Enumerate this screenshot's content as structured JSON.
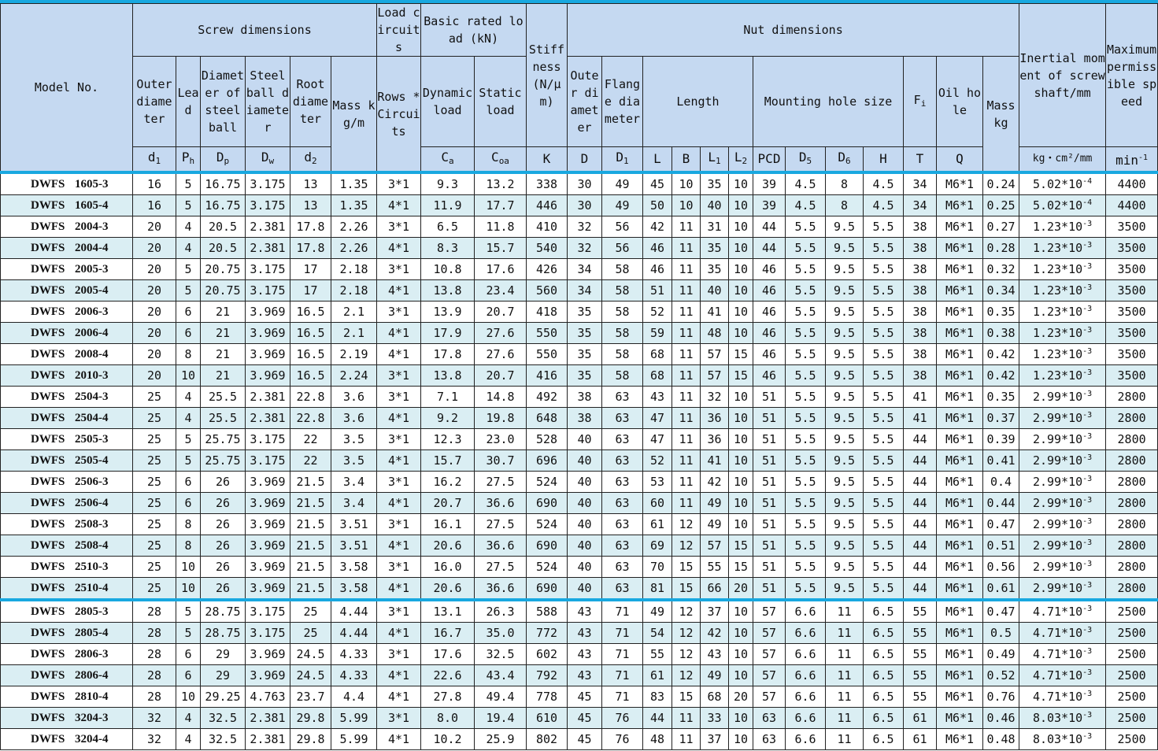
{
  "headers": {
    "model_no": "Model No.",
    "screw_dimensions": "Screw dimensions",
    "load_circuits": "Load circuits",
    "basic_rated_load": "Basic rated load (kN)",
    "stiffness": "Stiffness (N/μm)",
    "nut_dimensions": "Nut dimensions",
    "inertial_moment": "Inertial moment of screw shaft/mm",
    "max_speed": "Maximum permissible speed",
    "outer_diameter": "Outer diameter",
    "lead": "Lead",
    "steel_ball_circle": "Diameter of steel ball",
    "steel_ball_diameter": "Steel ball diameter",
    "root_diameter": "Root diameter",
    "mass_kg_m": "Mass kg/m",
    "rows_circuits": "Rows * Circuits",
    "dynamic_load": "Dynamic load",
    "static_load": "Static load",
    "nut_outer_diameter": "Outer diameter",
    "flange_diameter": "Flange diameter",
    "length": "Length",
    "mounting_hole_size": "Mounting hole size",
    "fi": "F",
    "fi_sub": "i",
    "oil_hole": "Oil hole",
    "mass_kg": "Mass kg",
    "sym": {
      "d1": "d",
      "d1_sub": "1",
      "ph": "P",
      "ph_sub": "h",
      "dp": "D",
      "dp_sub": "p",
      "dw": "D",
      "dw_sub": "w",
      "d2": "d",
      "d2_sub": "2",
      "ca": "C",
      "ca_sub": "a",
      "coa": "C",
      "coa_sub": "oa",
      "k": "K",
      "d": "D",
      "D1": "D",
      "D1_sub": "1",
      "l": "L",
      "b": "B",
      "l1": "L",
      "l1_sub": "1",
      "l2": "L",
      "l2_sub": "2",
      "pcd": "PCD",
      "d5": "D",
      "d5_sub": "5",
      "d6": "D",
      "d6_sub": "6",
      "h": "H",
      "t": "T",
      "q": "Q",
      "inertia_unit": "kg・cm²/mm",
      "speed_unit": "min",
      "speed_unit_sup": "-1"
    }
  },
  "rows": [
    {
      "p1": "DWFS",
      "p2": "1605-3",
      "d1": "16",
      "ph": "5",
      "dp": "16.75",
      "dw": "3.175",
      "d2": "13",
      "mass": "1.35",
      "rc": "3*1",
      "ca": "9.3",
      "coa": "13.2",
      "k": "338",
      "D": "30",
      "D1": "49",
      "L": "45",
      "B": "10",
      "L1": "35",
      "L2": "10",
      "PCD": "39",
      "D5": "4.5",
      "D6": "8",
      "H": "4.5",
      "T": "34",
      "Q": "M6*1",
      "nm": "0.24",
      "im": "5.02*10",
      "ie": "-4",
      "sp": "4400"
    },
    {
      "p1": "DWFS",
      "p2": "1605-4",
      "d1": "16",
      "ph": "5",
      "dp": "16.75",
      "dw": "3.175",
      "d2": "13",
      "mass": "1.35",
      "rc": "4*1",
      "ca": "11.9",
      "coa": "17.7",
      "k": "446",
      "D": "30",
      "D1": "49",
      "L": "50",
      "B": "10",
      "L1": "40",
      "L2": "10",
      "PCD": "39",
      "D5": "4.5",
      "D6": "8",
      "H": "4.5",
      "T": "34",
      "Q": "M6*1",
      "nm": "0.25",
      "im": "5.02*10",
      "ie": "-4",
      "sp": "4400"
    },
    {
      "p1": "DWFS",
      "p2": "2004-3",
      "d1": "20",
      "ph": "4",
      "dp": "20.5",
      "dw": "2.381",
      "d2": "17.8",
      "mass": "2.26",
      "rc": "3*1",
      "ca": "6.5",
      "coa": "11.8",
      "k": "410",
      "D": "32",
      "D1": "56",
      "L": "42",
      "B": "11",
      "L1": "31",
      "L2": "10",
      "PCD": "44",
      "D5": "5.5",
      "D6": "9.5",
      "H": "5.5",
      "T": "38",
      "Q": "M6*1",
      "nm": "0.27",
      "im": "1.23*10",
      "ie": "-3",
      "sp": "3500"
    },
    {
      "p1": "DWFS",
      "p2": "2004-4",
      "d1": "20",
      "ph": "4",
      "dp": "20.5",
      "dw": "2.381",
      "d2": "17.8",
      "mass": "2.26",
      "rc": "4*1",
      "ca": "8.3",
      "coa": "15.7",
      "k": "540",
      "D": "32",
      "D1": "56",
      "L": "46",
      "B": "11",
      "L1": "35",
      "L2": "10",
      "PCD": "44",
      "D5": "5.5",
      "D6": "9.5",
      "H": "5.5",
      "T": "38",
      "Q": "M6*1",
      "nm": "0.28",
      "im": "1.23*10",
      "ie": "-3",
      "sp": "3500"
    },
    {
      "p1": "DWFS",
      "p2": "2005-3",
      "d1": "20",
      "ph": "5",
      "dp": "20.75",
      "dw": "3.175",
      "d2": "17",
      "mass": "2.18",
      "rc": "3*1",
      "ca": "10.8",
      "coa": "17.6",
      "k": "426",
      "D": "34",
      "D1": "58",
      "L": "46",
      "B": "11",
      "L1": "35",
      "L2": "10",
      "PCD": "46",
      "D5": "5.5",
      "D6": "9.5",
      "H": "5.5",
      "T": "38",
      "Q": "M6*1",
      "nm": "0.32",
      "im": "1.23*10",
      "ie": "-3",
      "sp": "3500"
    },
    {
      "p1": "DWFS",
      "p2": "2005-4",
      "d1": "20",
      "ph": "5",
      "dp": "20.75",
      "dw": "3.175",
      "d2": "17",
      "mass": "2.18",
      "rc": "4*1",
      "ca": "13.8",
      "coa": "23.4",
      "k": "560",
      "D": "34",
      "D1": "58",
      "L": "51",
      "B": "11",
      "L1": "40",
      "L2": "10",
      "PCD": "46",
      "D5": "5.5",
      "D6": "9.5",
      "H": "5.5",
      "T": "38",
      "Q": "M6*1",
      "nm": "0.34",
      "im": "1.23*10",
      "ie": "-3",
      "sp": "3500"
    },
    {
      "p1": "DWFS",
      "p2": "2006-3",
      "d1": "20",
      "ph": "6",
      "dp": "21",
      "dw": "3.969",
      "d2": "16.5",
      "mass": "2.1",
      "rc": "3*1",
      "ca": "13.9",
      "coa": "20.7",
      "k": "418",
      "D": "35",
      "D1": "58",
      "L": "52",
      "B": "11",
      "L1": "41",
      "L2": "10",
      "PCD": "46",
      "D5": "5.5",
      "D6": "9.5",
      "H": "5.5",
      "T": "38",
      "Q": "M6*1",
      "nm": "0.35",
      "im": "1.23*10",
      "ie": "-3",
      "sp": "3500"
    },
    {
      "p1": "DWFS",
      "p2": "2006-4",
      "d1": "20",
      "ph": "6",
      "dp": "21",
      "dw": "3.969",
      "d2": "16.5",
      "mass": "2.1",
      "rc": "4*1",
      "ca": "17.9",
      "coa": "27.6",
      "k": "550",
      "D": "35",
      "D1": "58",
      "L": "59",
      "B": "11",
      "L1": "48",
      "L2": "10",
      "PCD": "46",
      "D5": "5.5",
      "D6": "9.5",
      "H": "5.5",
      "T": "38",
      "Q": "M6*1",
      "nm": "0.38",
      "im": "1.23*10",
      "ie": "-3",
      "sp": "3500"
    },
    {
      "p1": "DWFS",
      "p2": "2008-4",
      "d1": "20",
      "ph": "8",
      "dp": "21",
      "dw": "3.969",
      "d2": "16.5",
      "mass": "2.19",
      "rc": "4*1",
      "ca": "17.8",
      "coa": "27.6",
      "k": "550",
      "D": "35",
      "D1": "58",
      "L": "68",
      "B": "11",
      "L1": "57",
      "L2": "15",
      "PCD": "46",
      "D5": "5.5",
      "D6": "9.5",
      "H": "5.5",
      "T": "38",
      "Q": "M6*1",
      "nm": "0.42",
      "im": "1.23*10",
      "ie": "-3",
      "sp": "3500"
    },
    {
      "p1": "DWFS",
      "p2": "2010-3",
      "d1": "20",
      "ph": "10",
      "dp": "21",
      "dw": "3.969",
      "d2": "16.5",
      "mass": "2.24",
      "rc": "3*1",
      "ca": "13.8",
      "coa": "20.7",
      "k": "416",
      "D": "35",
      "D1": "58",
      "L": "68",
      "B": "11",
      "L1": "57",
      "L2": "15",
      "PCD": "46",
      "D5": "5.5",
      "D6": "9.5",
      "H": "5.5",
      "T": "38",
      "Q": "M6*1",
      "nm": "0.42",
      "im": "1.23*10",
      "ie": "-3",
      "sp": "3500"
    },
    {
      "p1": "DWFS",
      "p2": "2504-3",
      "d1": "25",
      "ph": "4",
      "dp": "25.5",
      "dw": "2.381",
      "d2": "22.8",
      "mass": "3.6",
      "rc": "3*1",
      "ca": "7.1",
      "coa": "14.8",
      "k": "492",
      "D": "38",
      "D1": "63",
      "L": "43",
      "B": "11",
      "L1": "32",
      "L2": "10",
      "PCD": "51",
      "D5": "5.5",
      "D6": "9.5",
      "H": "5.5",
      "T": "41",
      "Q": "M6*1",
      "nm": "0.35",
      "im": "2.99*10",
      "ie": "-3",
      "sp": "2800"
    },
    {
      "p1": "DWFS",
      "p2": "2504-4",
      "d1": "25",
      "ph": "4",
      "dp": "25.5",
      "dw": "2.381",
      "d2": "22.8",
      "mass": "3.6",
      "rc": "4*1",
      "ca": "9.2",
      "coa": "19.8",
      "k": "648",
      "D": "38",
      "D1": "63",
      "L": "47",
      "B": "11",
      "L1": "36",
      "L2": "10",
      "PCD": "51",
      "D5": "5.5",
      "D6": "9.5",
      "H": "5.5",
      "T": "41",
      "Q": "M6*1",
      "nm": "0.37",
      "im": "2.99*10",
      "ie": "-3",
      "sp": "2800"
    },
    {
      "p1": "DWFS",
      "p2": "2505-3",
      "d1": "25",
      "ph": "5",
      "dp": "25.75",
      "dw": "3.175",
      "d2": "22",
      "mass": "3.5",
      "rc": "3*1",
      "ca": "12.3",
      "coa": "23.0",
      "k": "528",
      "D": "40",
      "D1": "63",
      "L": "47",
      "B": "11",
      "L1": "36",
      "L2": "10",
      "PCD": "51",
      "D5": "5.5",
      "D6": "9.5",
      "H": "5.5",
      "T": "44",
      "Q": "M6*1",
      "nm": "0.39",
      "im": "2.99*10",
      "ie": "-3",
      "sp": "2800"
    },
    {
      "p1": "DWFS",
      "p2": "2505-4",
      "d1": "25",
      "ph": "5",
      "dp": "25.75",
      "dw": "3.175",
      "d2": "22",
      "mass": "3.5",
      "rc": "4*1",
      "ca": "15.7",
      "coa": "30.7",
      "k": "696",
      "D": "40",
      "D1": "63",
      "L": "52",
      "B": "11",
      "L1": "41",
      "L2": "10",
      "PCD": "51",
      "D5": "5.5",
      "D6": "9.5",
      "H": "5.5",
      "T": "44",
      "Q": "M6*1",
      "nm": "0.41",
      "im": "2.99*10",
      "ie": "-3",
      "sp": "2800"
    },
    {
      "p1": "DWFS",
      "p2": "2506-3",
      "d1": "25",
      "ph": "6",
      "dp": "26",
      "dw": "3.969",
      "d2": "21.5",
      "mass": "3.4",
      "rc": "3*1",
      "ca": "16.2",
      "coa": "27.5",
      "k": "524",
      "D": "40",
      "D1": "63",
      "L": "53",
      "B": "11",
      "L1": "42",
      "L2": "10",
      "PCD": "51",
      "D5": "5.5",
      "D6": "9.5",
      "H": "5.5",
      "T": "44",
      "Q": "M6*1",
      "nm": "0.4",
      "im": "2.99*10",
      "ie": "-3",
      "sp": "2800"
    },
    {
      "p1": "DWFS",
      "p2": "2506-4",
      "d1": "25",
      "ph": "6",
      "dp": "26",
      "dw": "3.969",
      "d2": "21.5",
      "mass": "3.4",
      "rc": "4*1",
      "ca": "20.7",
      "coa": "36.6",
      "k": "690",
      "D": "40",
      "D1": "63",
      "L": "60",
      "B": "11",
      "L1": "49",
      "L2": "10",
      "PCD": "51",
      "D5": "5.5",
      "D6": "9.5",
      "H": "5.5",
      "T": "44",
      "Q": "M6*1",
      "nm": "0.44",
      "im": "2.99*10",
      "ie": "-3",
      "sp": "2800"
    },
    {
      "p1": "DWFS",
      "p2": "2508-3",
      "d1": "25",
      "ph": "8",
      "dp": "26",
      "dw": "3.969",
      "d2": "21.5",
      "mass": "3.51",
      "rc": "3*1",
      "ca": "16.1",
      "coa": "27.5",
      "k": "524",
      "D": "40",
      "D1": "63",
      "L": "61",
      "B": "12",
      "L1": "49",
      "L2": "10",
      "PCD": "51",
      "D5": "5.5",
      "D6": "9.5",
      "H": "5.5",
      "T": "44",
      "Q": "M6*1",
      "nm": "0.47",
      "im": "2.99*10",
      "ie": "-3",
      "sp": "2800"
    },
    {
      "p1": "DWFS",
      "p2": "2508-4",
      "d1": "25",
      "ph": "8",
      "dp": "26",
      "dw": "3.969",
      "d2": "21.5",
      "mass": "3.51",
      "rc": "4*1",
      "ca": "20.6",
      "coa": "36.6",
      "k": "690",
      "D": "40",
      "D1": "63",
      "L": "69",
      "B": "12",
      "L1": "57",
      "L2": "15",
      "PCD": "51",
      "D5": "5.5",
      "D6": "9.5",
      "H": "5.5",
      "T": "44",
      "Q": "M6*1",
      "nm": "0.51",
      "im": "2.99*10",
      "ie": "-3",
      "sp": "2800"
    },
    {
      "p1": "DWFS",
      "p2": "2510-3",
      "d1": "25",
      "ph": "10",
      "dp": "26",
      "dw": "3.969",
      "d2": "21.5",
      "mass": "3.58",
      "rc": "3*1",
      "ca": "16.0",
      "coa": "27.5",
      "k": "524",
      "D": "40",
      "D1": "63",
      "L": "70",
      "B": "15",
      "L1": "55",
      "L2": "15",
      "PCD": "51",
      "D5": "5.5",
      "D6": "9.5",
      "H": "5.5",
      "T": "44",
      "Q": "M6*1",
      "nm": "0.56",
      "im": "2.99*10",
      "ie": "-3",
      "sp": "2800"
    },
    {
      "p1": "DWFS",
      "p2": "2510-4",
      "d1": "25",
      "ph": "10",
      "dp": "26",
      "dw": "3.969",
      "d2": "21.5",
      "mass": "3.58",
      "rc": "4*1",
      "ca": "20.6",
      "coa": "36.6",
      "k": "690",
      "D": "40",
      "D1": "63",
      "L": "81",
      "B": "15",
      "L1": "66",
      "L2": "20",
      "PCD": "51",
      "D5": "5.5",
      "D6": "9.5",
      "H": "5.5",
      "T": "44",
      "Q": "M6*1",
      "nm": "0.61",
      "im": "2.99*10",
      "ie": "-3",
      "sp": "2800"
    },
    {
      "p1": "DWFS",
      "p2": "2805-3",
      "d1": "28",
      "ph": "5",
      "dp": "28.75",
      "dw": "3.175",
      "d2": "25",
      "mass": "4.44",
      "rc": "3*1",
      "ca": "13.1",
      "coa": "26.3",
      "k": "588",
      "D": "43",
      "D1": "71",
      "L": "49",
      "B": "12",
      "L1": "37",
      "L2": "10",
      "PCD": "57",
      "D5": "6.6",
      "D6": "11",
      "H": "6.5",
      "T": "55",
      "Q": "M6*1",
      "nm": "0.47",
      "im": "4.71*10",
      "ie": "-3",
      "sp": "2500"
    },
    {
      "p1": "DWFS",
      "p2": "2805-4",
      "d1": "28",
      "ph": "5",
      "dp": "28.75",
      "dw": "3.175",
      "d2": "25",
      "mass": "4.44",
      "rc": "4*1",
      "ca": "16.7",
      "coa": "35.0",
      "k": "772",
      "D": "43",
      "D1": "71",
      "L": "54",
      "B": "12",
      "L1": "42",
      "L2": "10",
      "PCD": "57",
      "D5": "6.6",
      "D6": "11",
      "H": "6.5",
      "T": "55",
      "Q": "M6*1",
      "nm": "0.5",
      "im": "4.71*10",
      "ie": "-3",
      "sp": "2500"
    },
    {
      "p1": "DWFS",
      "p2": "2806-3",
      "d1": "28",
      "ph": "6",
      "dp": "29",
      "dw": "3.969",
      "d2": "24.5",
      "mass": "4.33",
      "rc": "3*1",
      "ca": "17.6",
      "coa": "32.5",
      "k": "602",
      "D": "43",
      "D1": "71",
      "L": "55",
      "B": "12",
      "L1": "43",
      "L2": "10",
      "PCD": "57",
      "D5": "6.6",
      "D6": "11",
      "H": "6.5",
      "T": "55",
      "Q": "M6*1",
      "nm": "0.49",
      "im": "4.71*10",
      "ie": "-3",
      "sp": "2500"
    },
    {
      "p1": "DWFS",
      "p2": "2806-4",
      "d1": "28",
      "ph": "6",
      "dp": "29",
      "dw": "3.969",
      "d2": "24.5",
      "mass": "4.33",
      "rc": "4*1",
      "ca": "22.6",
      "coa": "43.4",
      "k": "792",
      "D": "43",
      "D1": "71",
      "L": "61",
      "B": "12",
      "L1": "49",
      "L2": "10",
      "PCD": "57",
      "D5": "6.6",
      "D6": "11",
      "H": "6.5",
      "T": "55",
      "Q": "M6*1",
      "nm": "0.52",
      "im": "4.71*10",
      "ie": "-3",
      "sp": "2500"
    },
    {
      "p1": "DWFS",
      "p2": "2810-4",
      "d1": "28",
      "ph": "10",
      "dp": "29.25",
      "dw": "4.763",
      "d2": "23.7",
      "mass": "4.4",
      "rc": "4*1",
      "ca": "27.8",
      "coa": "49.4",
      "k": "778",
      "D": "45",
      "D1": "71",
      "L": "83",
      "B": "15",
      "L1": "68",
      "L2": "20",
      "PCD": "57",
      "D5": "6.6",
      "D6": "11",
      "H": "6.5",
      "T": "55",
      "Q": "M6*1",
      "nm": "0.76",
      "im": "4.71*10",
      "ie": "-3",
      "sp": "2500"
    },
    {
      "p1": "DWFS",
      "p2": "3204-3",
      "d1": "32",
      "ph": "4",
      "dp": "32.5",
      "dw": "2.381",
      "d2": "29.8",
      "mass": "5.99",
      "rc": "3*1",
      "ca": "8.0",
      "coa": "19.4",
      "k": "610",
      "D": "45",
      "D1": "76",
      "L": "44",
      "B": "11",
      "L1": "33",
      "L2": "10",
      "PCD": "63",
      "D5": "6.6",
      "D6": "11",
      "H": "6.5",
      "T": "61",
      "Q": "M6*1",
      "nm": "0.46",
      "im": "8.03*10",
      "ie": "-3",
      "sp": "2500"
    },
    {
      "p1": "DWFS",
      "p2": "3204-4",
      "d1": "32",
      "ph": "4",
      "dp": "32.5",
      "dw": "2.381",
      "d2": "29.8",
      "mass": "5.99",
      "rc": "4*1",
      "ca": "10.2",
      "coa": "25.9",
      "k": "802",
      "D": "45",
      "D1": "76",
      "L": "48",
      "B": "11",
      "L1": "37",
      "L2": "10",
      "PCD": "63",
      "D5": "6.6",
      "D6": "11",
      "H": "6.5",
      "T": "61",
      "Q": "M6*1",
      "nm": "0.48",
      "im": "8.03*10",
      "ie": "-3",
      "sp": "2500"
    }
  ]
}
